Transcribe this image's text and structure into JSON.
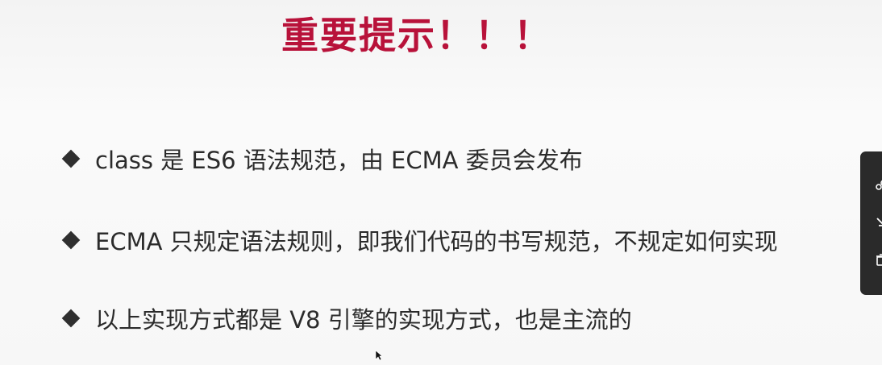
{
  "slide": {
    "title": "重要提示！！！",
    "bullets": [
      "class 是 ES6 语法规范，由 ECMA 委员会发布",
      "ECMA 只规定语法规则，即我们代码的书写规范，不规定如何实现",
      "以上实现方式都是 V8 引擎的实现方式，也是主流的"
    ]
  },
  "colors": {
    "title": "#b8123a",
    "text": "#2b2b2b",
    "side_panel": "#2a2a2a"
  },
  "side_panel": {
    "icons": [
      "link-icon",
      "download-icon",
      "delete-icon"
    ]
  }
}
